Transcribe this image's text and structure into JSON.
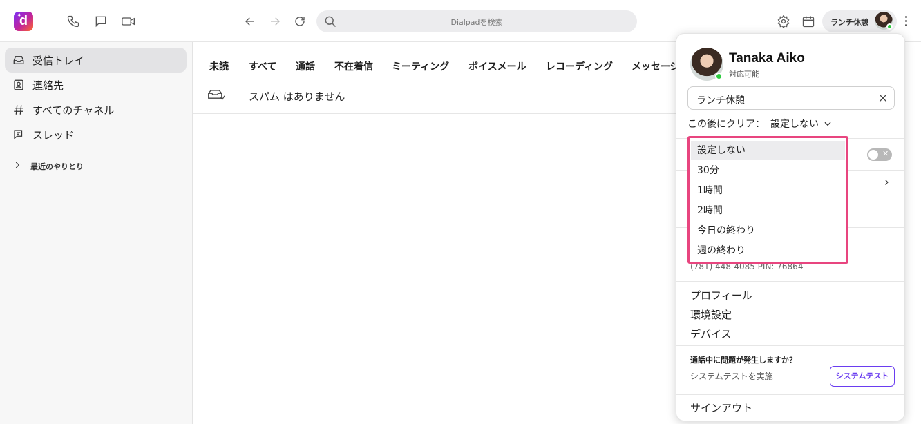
{
  "toolbar": {
    "logo_letter": "d",
    "search_placeholder": "Dialpadを検索",
    "status_label": "ランチ休憩"
  },
  "sidebar": {
    "items": [
      {
        "label": "受信トレイ",
        "icon": "inbox-icon",
        "active": true
      },
      {
        "label": "連絡先",
        "icon": "contacts-icon"
      },
      {
        "label": "すべてのチャネル",
        "icon": "hash-icon"
      },
      {
        "label": "スレッド",
        "icon": "threads-icon"
      }
    ],
    "recent_label": "最近のやりとり"
  },
  "tabs": [
    "未読",
    "すべて",
    "通話",
    "不在着信",
    "ミーティング",
    "ボイスメール",
    "レコーディング",
    "メッセージ"
  ],
  "inbox": {
    "empty_text": "スパム はありません"
  },
  "profile": {
    "name": "Tanaka Aiko",
    "availability": "対応可能",
    "status_value": "ランチ休憩",
    "clear_after_label": "この後にクリア：",
    "clear_after_value": "設定しない",
    "phone_line": "(781) 448-4085 PIN: 76864",
    "links": [
      "プロフィール",
      "環境設定",
      "デバイス"
    ],
    "issue_heading": "通話中に問題が発生しますか？",
    "issue_sub": "システムテストを実施",
    "system_test_button": "システムテスト",
    "sign_out": "サインアウト"
  },
  "dropdown": {
    "options": [
      "設定しない",
      "30分",
      "1時間",
      "2時間",
      "今日の終わり",
      "週の終わり"
    ],
    "selected": "設定しない",
    "highlight_color": "#e8457f"
  },
  "colors": {
    "accent": "#6a3df0",
    "online": "#2ecc40"
  }
}
